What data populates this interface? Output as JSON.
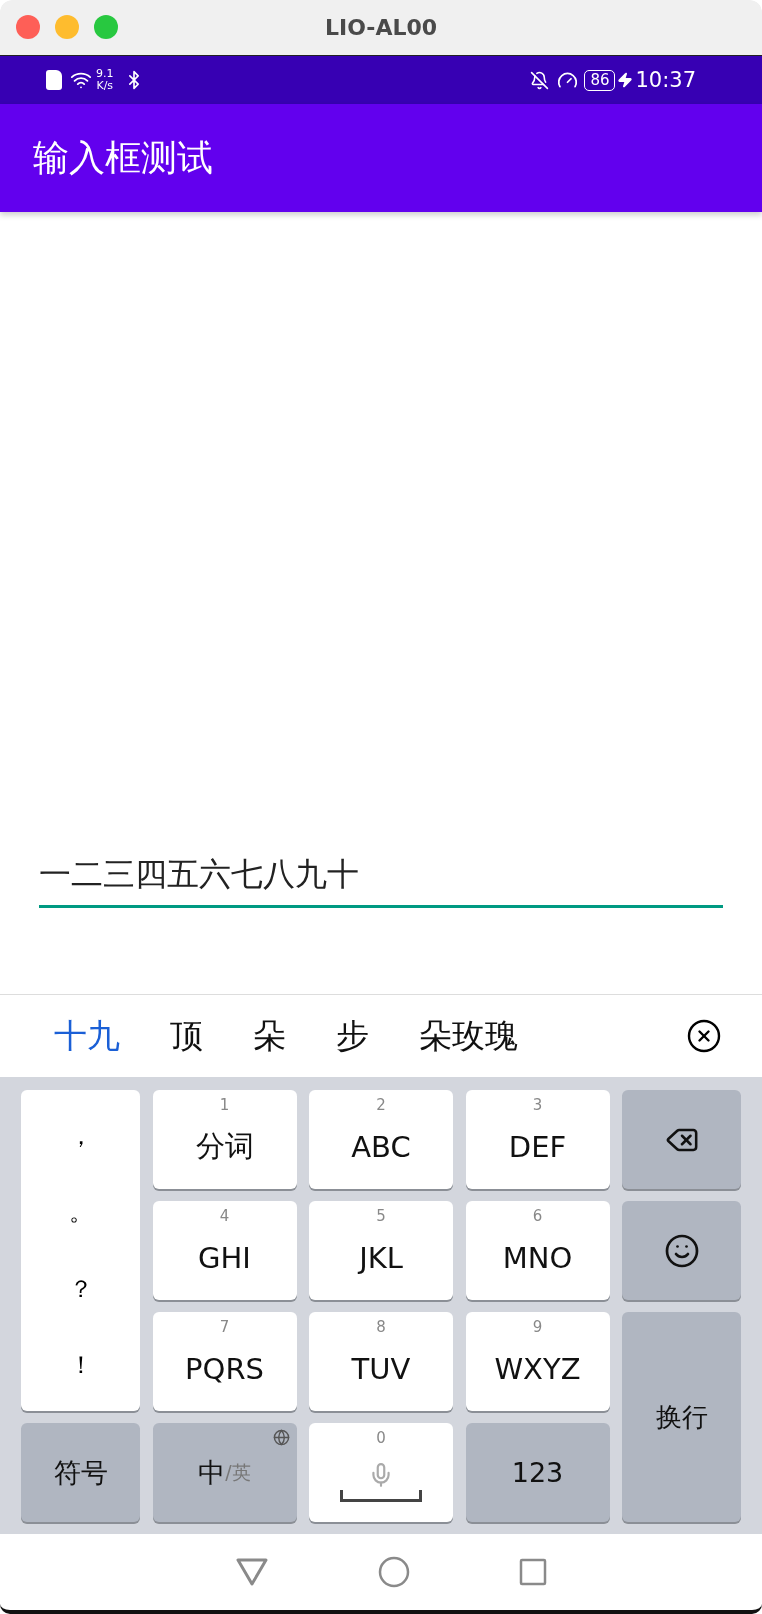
{
  "window": {
    "title": "LIO-AL00"
  },
  "status_bar": {
    "speed_value": "9.1",
    "speed_unit": "K/s",
    "battery": "86",
    "time": "10:37"
  },
  "app_bar": {
    "title": "输入框测试"
  },
  "input": {
    "value": "一二三四五六七八九十",
    "focused": true
  },
  "candidates": [
    {
      "text": "十九",
      "selected": true
    },
    {
      "text": "顶",
      "selected": false
    },
    {
      "text": "朵",
      "selected": false
    },
    {
      "text": "步",
      "selected": false
    },
    {
      "text": "朵玫瑰",
      "selected": false
    }
  ],
  "keyboard": {
    "keys": [
      {
        "kind": "punctuation",
        "marks": [
          "，",
          "。",
          "？",
          "！"
        ]
      },
      {
        "kind": "digit",
        "number": "1",
        "label": "分词"
      },
      {
        "kind": "digit",
        "number": "2",
        "label": "ABC"
      },
      {
        "kind": "digit",
        "number": "3",
        "label": "DEF"
      },
      {
        "kind": "backspace"
      },
      {
        "kind": "digit",
        "number": "4",
        "label": "GHI"
      },
      {
        "kind": "digit",
        "number": "5",
        "label": "JKL"
      },
      {
        "kind": "digit",
        "number": "6",
        "label": "MNO"
      },
      {
        "kind": "emoji"
      },
      {
        "kind": "digit",
        "number": "7",
        "label": "PQRS"
      },
      {
        "kind": "digit",
        "number": "8",
        "label": "TUV"
      },
      {
        "kind": "digit",
        "number": "9",
        "label": "WXYZ"
      },
      {
        "kind": "enter",
        "label": "换行"
      },
      {
        "kind": "function",
        "label": "符号"
      },
      {
        "kind": "language",
        "label": "中",
        "alt": "/英"
      },
      {
        "kind": "space",
        "number": "0"
      },
      {
        "kind": "function",
        "label": "123"
      }
    ]
  }
}
